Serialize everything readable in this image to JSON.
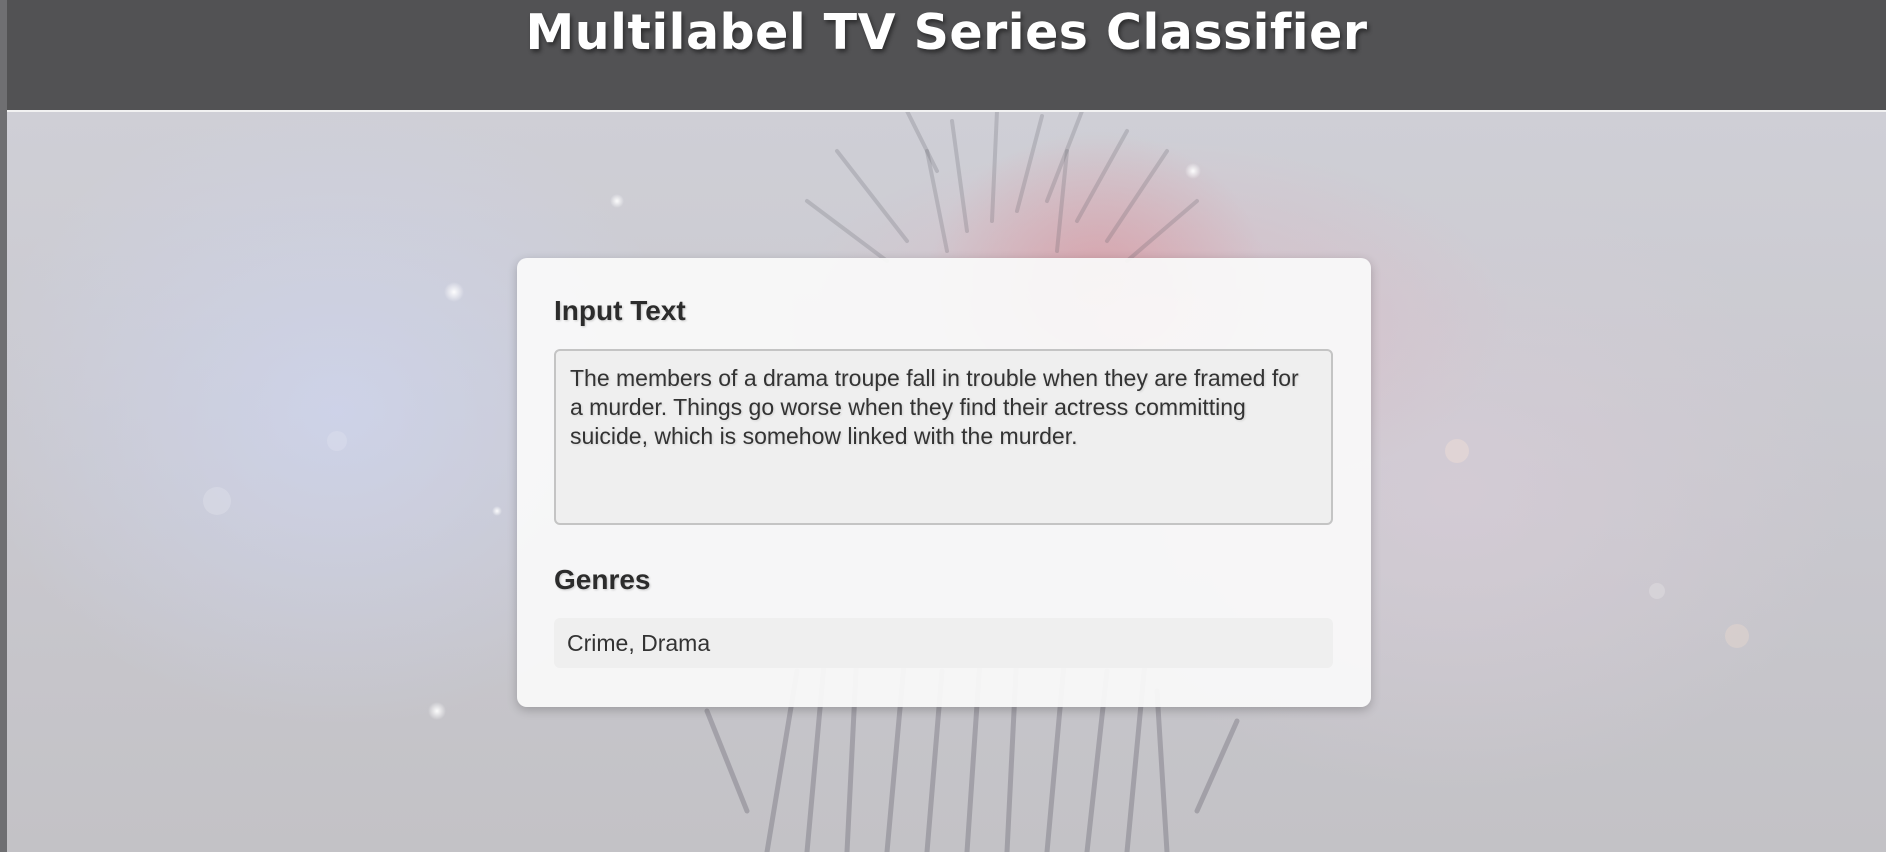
{
  "header": {
    "title": "Multilabel TV Series Classifier"
  },
  "input_section": {
    "heading": "Input Text",
    "text": "The members of a drama troupe fall in trouble when they are framed for a murder. Things go worse when they find their actress committing suicide, which is somehow linked with the murder."
  },
  "genres_section": {
    "heading": "Genres",
    "value": "Crime, Drama"
  },
  "colors": {
    "header_background": "#525254",
    "header_text": "#ffffff",
    "card_background": "#fafafa",
    "field_background": "#efefef",
    "text": "#333333"
  }
}
